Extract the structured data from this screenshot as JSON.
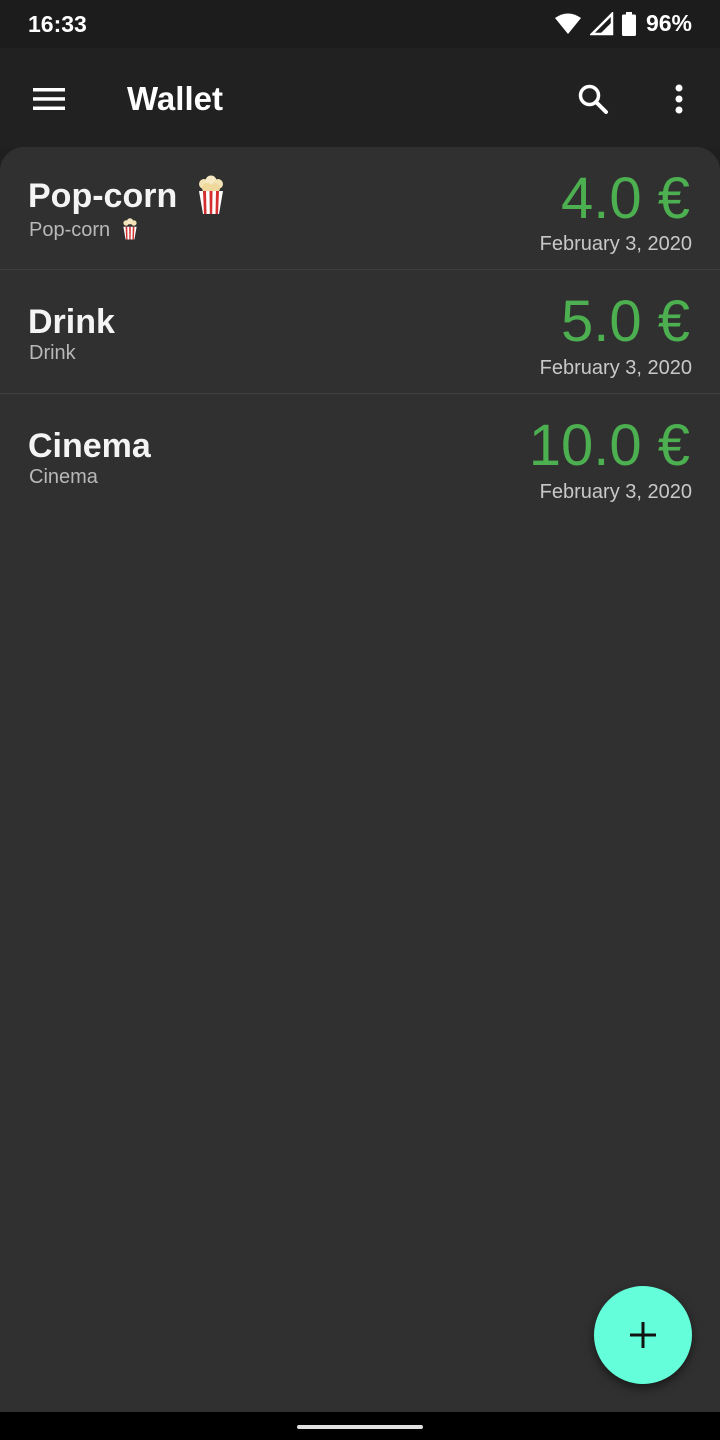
{
  "status_bar": {
    "time": "16:33",
    "battery_percent": "96%",
    "icons": [
      "wifi-icon",
      "cell-signal-icon",
      "battery-icon"
    ]
  },
  "app_bar": {
    "title": "Wallet",
    "icons": [
      "menu-icon",
      "search-icon",
      "more-vert-icon"
    ]
  },
  "transactions": [
    {
      "title": "Pop-corn",
      "subtitle": "Pop-corn",
      "amount": "4.0 €",
      "date": "February 3, 2020",
      "emoji": "popcorn-icon"
    },
    {
      "title": "Drink",
      "subtitle": "Drink",
      "amount": "5.0 €",
      "date": "February 3, 2020"
    },
    {
      "title": "Cinema",
      "subtitle": "Cinema",
      "amount": "10.0 €",
      "date": "February 3, 2020"
    }
  ],
  "fab": {
    "icon": "plus-icon"
  },
  "colors": {
    "amount": "#4caf50",
    "fab": "#64ffda",
    "background": "#303030",
    "app_bar": "#212121"
  }
}
